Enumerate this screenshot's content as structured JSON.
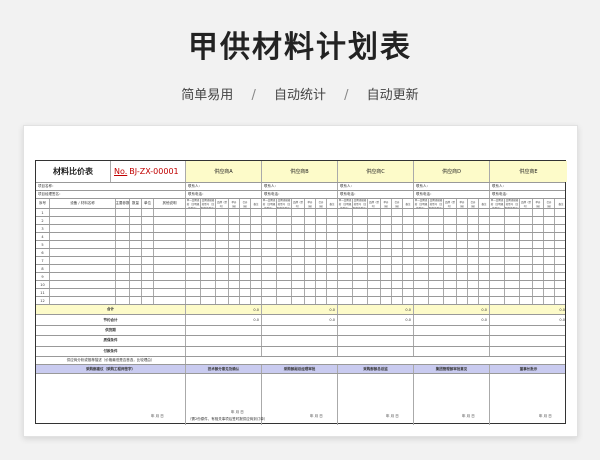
{
  "header": {
    "title": "甲供材料计划表"
  },
  "subnav": {
    "items": [
      "简单易用",
      "自动统计",
      "自动更新"
    ],
    "separator": "/"
  },
  "sheet": {
    "title": "材料比价表",
    "no_label": "No.",
    "no_value": "BJ-ZX-00001",
    "suppliers": [
      "供应商A",
      "供应商B",
      "供应商C",
      "供应商D",
      "供应商E"
    ],
    "info_rows": [
      "项目名称：",
      "项目经理签名："
    ],
    "contact_labels": [
      "联系人：",
      "联系电话："
    ],
    "columns": [
      "序号",
      "设备 / 材料名称",
      "主要参数",
      "数量",
      "单位",
      "其他说明"
    ],
    "supplier_columns": [
      "单一品牌或的（注明规格型号）",
      "品牌或规格的型号（注明规格型号）",
      "品牌（型号）",
      "单价（元）",
      "合价（元）",
      "备注"
    ],
    "row_numbers": [
      "1",
      "2",
      "3",
      "4",
      "5",
      "6",
      "7",
      "8",
      "9",
      "10",
      "11",
      "12"
    ],
    "summary_rows": [
      "合计",
      "节约合计",
      "供货期",
      "质保条件",
      "付款条件"
    ],
    "total_value": "0.0",
    "recommend_row": "供应商分析或推荐描述（价格最低是否首选，比较理由）",
    "sign_headers": [
      "采购部建议（采购工程师签字）",
      "技术部分意见及确认",
      "采购部副总经理审批",
      "采购部部总总监",
      "集团管理部审批意见",
      "董事长批示"
    ],
    "sign_footer": "年  月  日",
    "sign_note": "（需2份原件，有相关事项后签时报供应商到订单）"
  }
}
